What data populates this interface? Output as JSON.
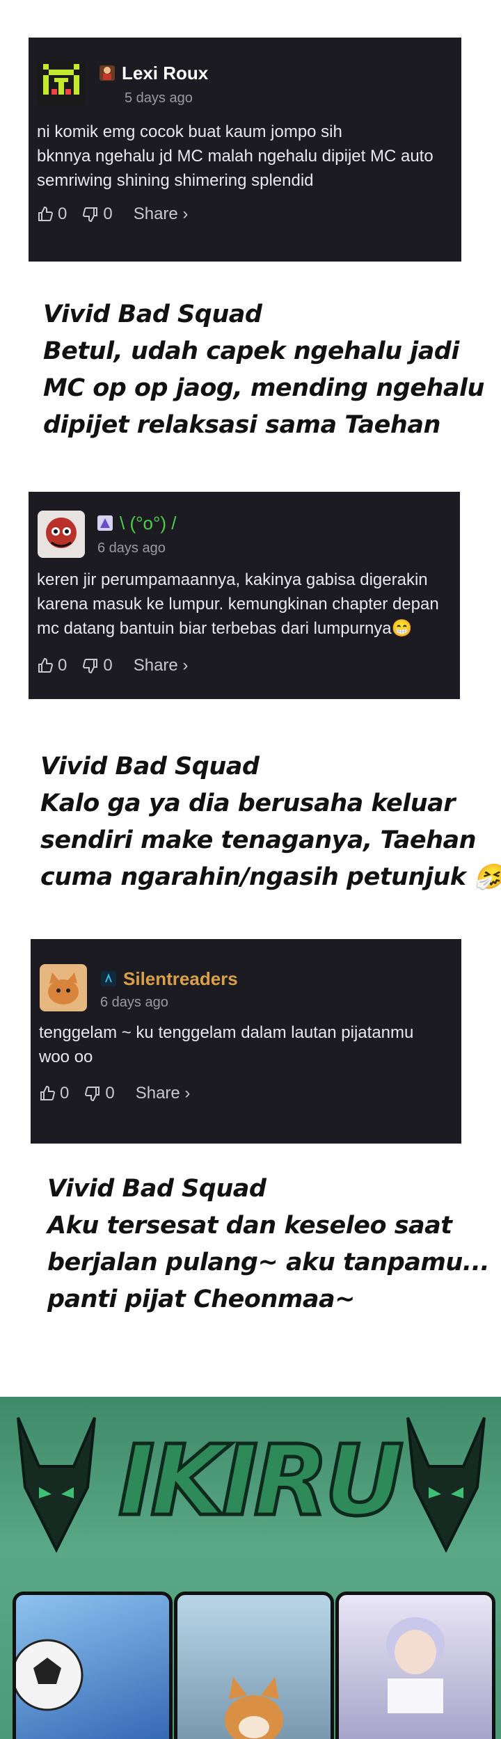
{
  "comments": [
    {
      "username": "Lexi Roux",
      "badge_icon": "character-badge-icon",
      "time": "5 days ago",
      "text_lines": [
        "ni komik emg cocok buat kaum jompo sih",
        "bknnya ngehalu jd MC malah ngehalu dipijet MC auto",
        "semriwing shining shimering splendid"
      ],
      "likes": "0",
      "dislikes": "0",
      "share_label": "Share ›",
      "username_color": "#ffffff"
    },
    {
      "username": "\\ (°o°) /",
      "badge_icon": "character-badge-icon",
      "time": "6 days ago",
      "text_lines": [
        "keren jir perumpamaannya, kakinya gabisa digerakin",
        "karena masuk ke lumpur. kemungkinan chapter depan",
        "mc datang bantuin biar terbebas dari lumpurnya😁"
      ],
      "likes": "0",
      "dislikes": "0",
      "share_label": "Share ›",
      "username_color": "#4cd04c"
    },
    {
      "username": "Silentreaders",
      "badge_icon": "rank-badge-icon",
      "time": "6 days ago",
      "text_lines": [
        "tenggelam ~ ku tenggelam dalam lautan pijatanmu",
        "woo oo"
      ],
      "likes": "0",
      "dislikes": "0",
      "share_label": "Share ›",
      "username_color": "#d9a04a"
    }
  ],
  "replies": [
    {
      "lines": [
        "Vivid Bad Squad",
        "Betul, udah capek ngehalu jadi",
        "MC op op jaog, mending ngehalu",
        "dipijet relaksasi sama Taehan"
      ]
    },
    {
      "lines": [
        "Vivid Bad Squad",
        "Kalo ga ya dia berusaha keluar",
        " sendiri make tenaganya, Taehan",
        "cuma ngarahin/ngasih petunjuk 🤧"
      ]
    },
    {
      "lines": [
        "Vivid Bad Squad",
        "Aku tersesat dan keseleo saat",
        "berjalan pulang~ aku tanpamu...",
        "panti pijat Cheonmaa~"
      ]
    }
  ],
  "banner": {
    "logo_text": "IKIRU"
  }
}
